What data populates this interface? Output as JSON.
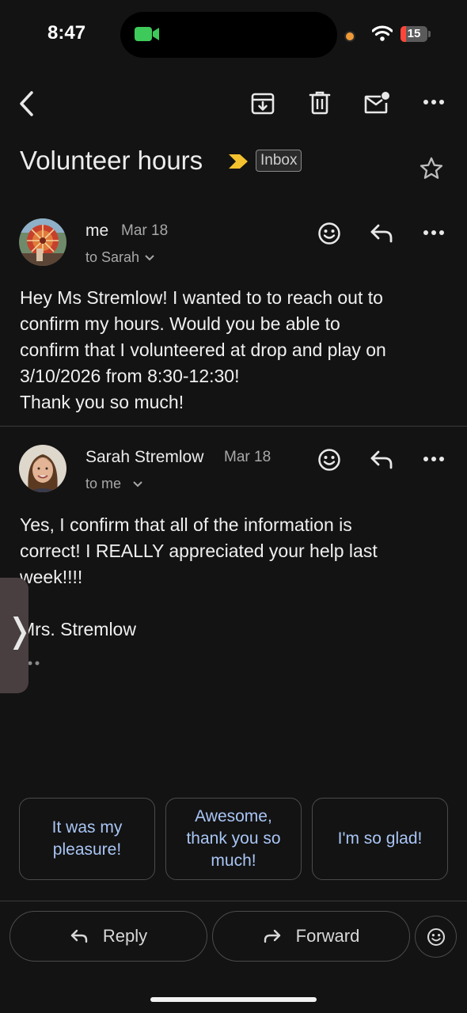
{
  "status_bar": {
    "time": "8:47",
    "battery": "15"
  },
  "email": {
    "subject": "Volunteer hours",
    "label": "Inbox"
  },
  "messages": [
    {
      "sender": "me",
      "date": "Mar 18",
      "to": "to Sarah",
      "body": [
        "Hey Ms Stremlow! I wanted to to reach out to",
        "confirm my hours. Would you be able to",
        "confirm that I volunteered at drop and play on",
        "3/10/2026 from 8:30-12:30!",
        "Thank you so much!"
      ]
    },
    {
      "sender": "Sarah Stremlow",
      "date": "Mar 18",
      "to": "to me",
      "body": [
        "Yes, I confirm that all of the information is",
        "correct!  I REALLY appreciated your help last",
        "week!!!!",
        "",
        "Mrs. Stremlow"
      ]
    }
  ],
  "smart_replies": [
    "It was my pleasure!",
    "Awesome, thank you so much!",
    "I'm so glad!"
  ],
  "actions": {
    "reply": "Reply",
    "forward": "Forward"
  },
  "colors": {
    "accent": "#a9c5f5",
    "background": "#131313",
    "important": "#f4c12f",
    "facetime": "#3ec95b"
  }
}
